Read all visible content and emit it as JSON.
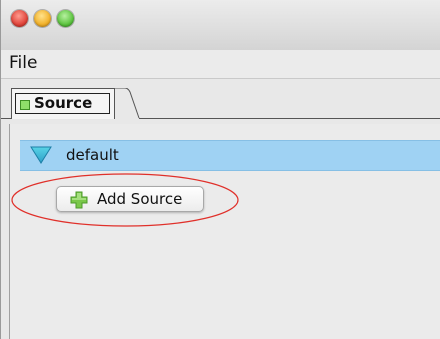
{
  "menubar": {
    "file_label": "File"
  },
  "tabs": [
    {
      "label": "Source",
      "active": true
    }
  ],
  "tree": {
    "nodes": [
      {
        "label": "default",
        "expanded": true,
        "selected": true
      }
    ]
  },
  "popup": {
    "add_source_label": "Add Source"
  },
  "icons": {
    "window_close": "close-icon",
    "window_minimize": "minimize-icon",
    "window_zoom": "zoom-icon",
    "tab_indicator": "green-square-icon",
    "tree_toggle": "triangle-down-icon",
    "add": "plus-icon"
  },
  "colors": {
    "selection": "#9fd2f3",
    "annotation": "#e0302a",
    "plus_green": "#67b93a"
  }
}
